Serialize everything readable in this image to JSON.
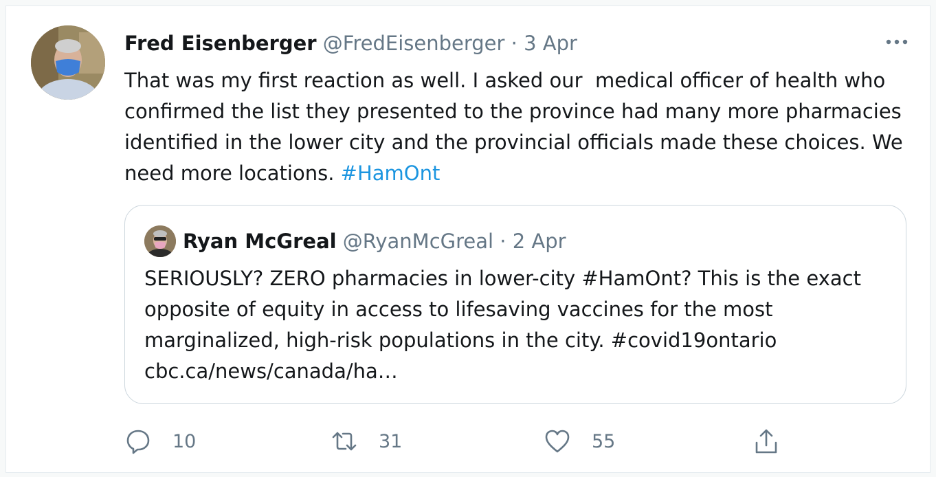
{
  "tweet": {
    "author_name": "Fred Eisenberger",
    "author_handle": "@FredEisenberger",
    "separator": "·",
    "date": "3 Apr",
    "text_main": "That was my first reaction as well. I asked our  medical officer of health who confirmed the list they presented to the province had many more pharmacies identified in the lower city and the provincial officials made these choices. We need more locations. ",
    "hashtag": "#HamOnt"
  },
  "quoted_tweet": {
    "author_name": "Ryan McGreal",
    "author_handle": "@RyanMcGreal",
    "separator": "·",
    "date": "2 Apr",
    "text": "SERIOUSLY? ZERO pharmacies in lower-city #HamOnt? This is the exact opposite of equity in access to lifesaving vaccines for the most marginalized, high-risk populations in the city. #covid19ontario cbc.ca/news/canada/ha…"
  },
  "actions": {
    "reply_count": "10",
    "retweet_count": "31",
    "like_count": "55"
  },
  "icons": {
    "more": "more-horizontal-icon",
    "reply": "reply-icon",
    "retweet": "retweet-icon",
    "like": "heart-icon",
    "share": "share-icon"
  },
  "colors": {
    "link": "#1b95e0",
    "secondary_text": "#657786",
    "primary_text": "#14171a",
    "border": "#ccd6dd"
  }
}
